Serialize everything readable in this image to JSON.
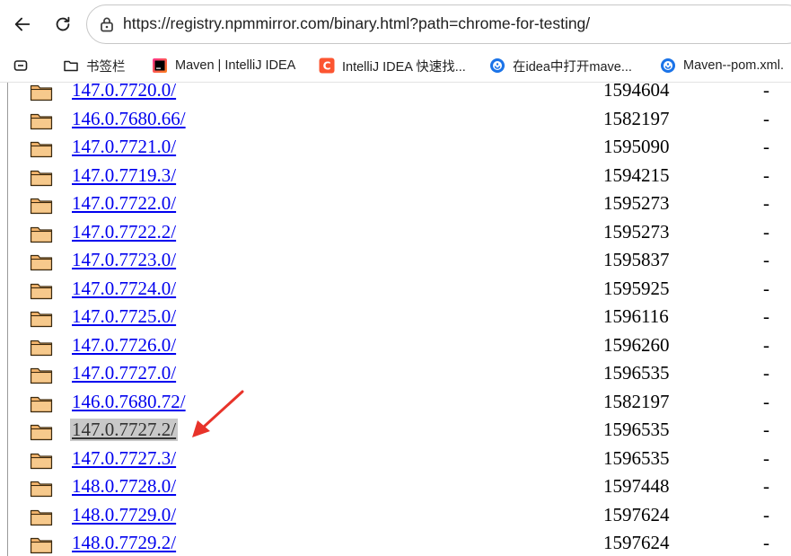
{
  "browser": {
    "url": "https://registry.npmmirror.com/binary.html?path=chrome-for-testing/",
    "bookmarks": [
      {
        "label": "书签栏",
        "icon": "folder-icon"
      },
      {
        "label": "Maven | IntelliJ IDEA",
        "icon": "intellij-icon"
      },
      {
        "label": "IntelliJ IDEA 快速找...",
        "icon": "csdn-icon"
      },
      {
        "label": "在idea中打开mave...",
        "icon": "globe-icon"
      },
      {
        "label": "Maven--pom.xml.",
        "icon": "globe-icon"
      }
    ]
  },
  "listing": {
    "rows": [
      {
        "name": "147.0.7720.0/",
        "size": "1594604",
        "date": "-"
      },
      {
        "name": "146.0.7680.66/",
        "size": "1582197",
        "date": "-"
      },
      {
        "name": "147.0.7721.0/",
        "size": "1595090",
        "date": "-"
      },
      {
        "name": "147.0.7719.3/",
        "size": "1594215",
        "date": "-"
      },
      {
        "name": "147.0.7722.0/",
        "size": "1595273",
        "date": "-"
      },
      {
        "name": "147.0.7722.2/",
        "size": "1595273",
        "date": "-"
      },
      {
        "name": "147.0.7723.0/",
        "size": "1595837",
        "date": "-"
      },
      {
        "name": "147.0.7724.0/",
        "size": "1595925",
        "date": "-"
      },
      {
        "name": "147.0.7725.0/",
        "size": "1596116",
        "date": "-"
      },
      {
        "name": "147.0.7726.0/",
        "size": "1596260",
        "date": "-"
      },
      {
        "name": "147.0.7727.0/",
        "size": "1596535",
        "date": "-"
      },
      {
        "name": "146.0.7680.72/",
        "size": "1582197",
        "date": "-"
      },
      {
        "name": "147.0.7727.2/",
        "size": "1596535",
        "date": "-",
        "highlighted": true
      },
      {
        "name": "147.0.7727.3/",
        "size": "1596535",
        "date": "-"
      },
      {
        "name": "148.0.7728.0/",
        "size": "1597448",
        "date": "-"
      },
      {
        "name": "148.0.7729.0/",
        "size": "1597624",
        "date": "-"
      },
      {
        "name": "148.0.7729.2/",
        "size": "1597624",
        "date": "-"
      }
    ]
  },
  "colors": {
    "link": "#0000ee",
    "highlight_bg": "#c8c8c8",
    "annotation_arrow": "#e8332a",
    "folder_fill": "#f2b36b"
  }
}
